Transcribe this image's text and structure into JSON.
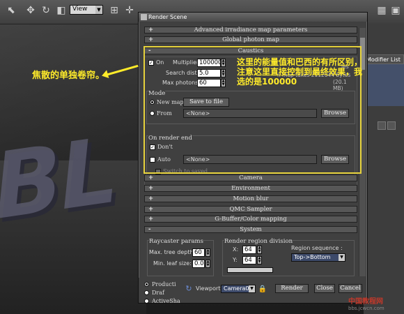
{
  "toolbar": {
    "view_label": "View"
  },
  "right_panel": {
    "modifier_list": "Modifier List"
  },
  "dialog": {
    "title": "Render Scene",
    "rollouts_top": [
      {
        "sign": "+",
        "label": "Advanced irradiance map parameters"
      },
      {
        "sign": "+",
        "label": "Global photon map"
      },
      {
        "sign": "-",
        "label": "Caustics"
      }
    ],
    "caustics": {
      "on_label": "On",
      "multiplier_label": "Multiplier:",
      "multiplier_value": "100000",
      "search_dist_label": "Search dist:",
      "search_dist_value": "5.0",
      "max_photons_label": "Max photons:",
      "max_photons_value": "60",
      "info_line1": "les",
      "info_line2": "n map takes 2112044 bytes",
      "info_line3": "(20.1 MB)",
      "mode_title": "Mode",
      "new_map_label": "New map",
      "save_to_file_label": "Save to file",
      "from_label": "From",
      "from_value": "<None>",
      "browse_label": "Browse",
      "on_render_end_title": "On render end",
      "dont_label": "Don't",
      "auto_label": "Auto",
      "auto_value": "<None>",
      "switch_label": "Switch to saved"
    },
    "rollouts_bottom": [
      {
        "sign": "+",
        "label": "Camera"
      },
      {
        "sign": "+",
        "label": "Environment"
      },
      {
        "sign": "+",
        "label": "Motion blur"
      },
      {
        "sign": "+",
        "label": "QMC Sampler"
      },
      {
        "sign": "+",
        "label": "G-Buffer/Color mapping"
      },
      {
        "sign": "-",
        "label": "System"
      }
    ],
    "system": {
      "raycaster_title": "Raycaster params",
      "max_tree_depth_label": "Max. tree depth:",
      "max_tree_depth_value": "60",
      "min_leaf_size_label": "Min. leaf size:",
      "min_leaf_size_value": "0.0",
      "region_title": "Render region division",
      "x_label": "X:",
      "x_value": "64",
      "y_label": "Y:",
      "y_value": "64",
      "region_sequence_label": "Region sequence :",
      "region_sequence_value": "Top->Bottom"
    },
    "bottom": {
      "production_label": "Producti",
      "draft_label": "Draf",
      "activeshade_label": "ActiveSha",
      "viewport_label": "Viewport:",
      "viewport_value": "Camera01",
      "render_label": "Render",
      "close_label": "Close",
      "cancel_label": "Cancel"
    }
  },
  "annotations": {
    "left_note": "焦散的单独卷帘。",
    "right_note": "这里的能量值和巴西的有所区别，注意这里直接控制到最终效果，我选的是100000"
  },
  "watermark": {
    "title": "中国教程网",
    "url": "bbs.jcwcn.com"
  },
  "colors": {
    "annotation": "#ffeb2a",
    "dialog_bg": "#404040"
  }
}
